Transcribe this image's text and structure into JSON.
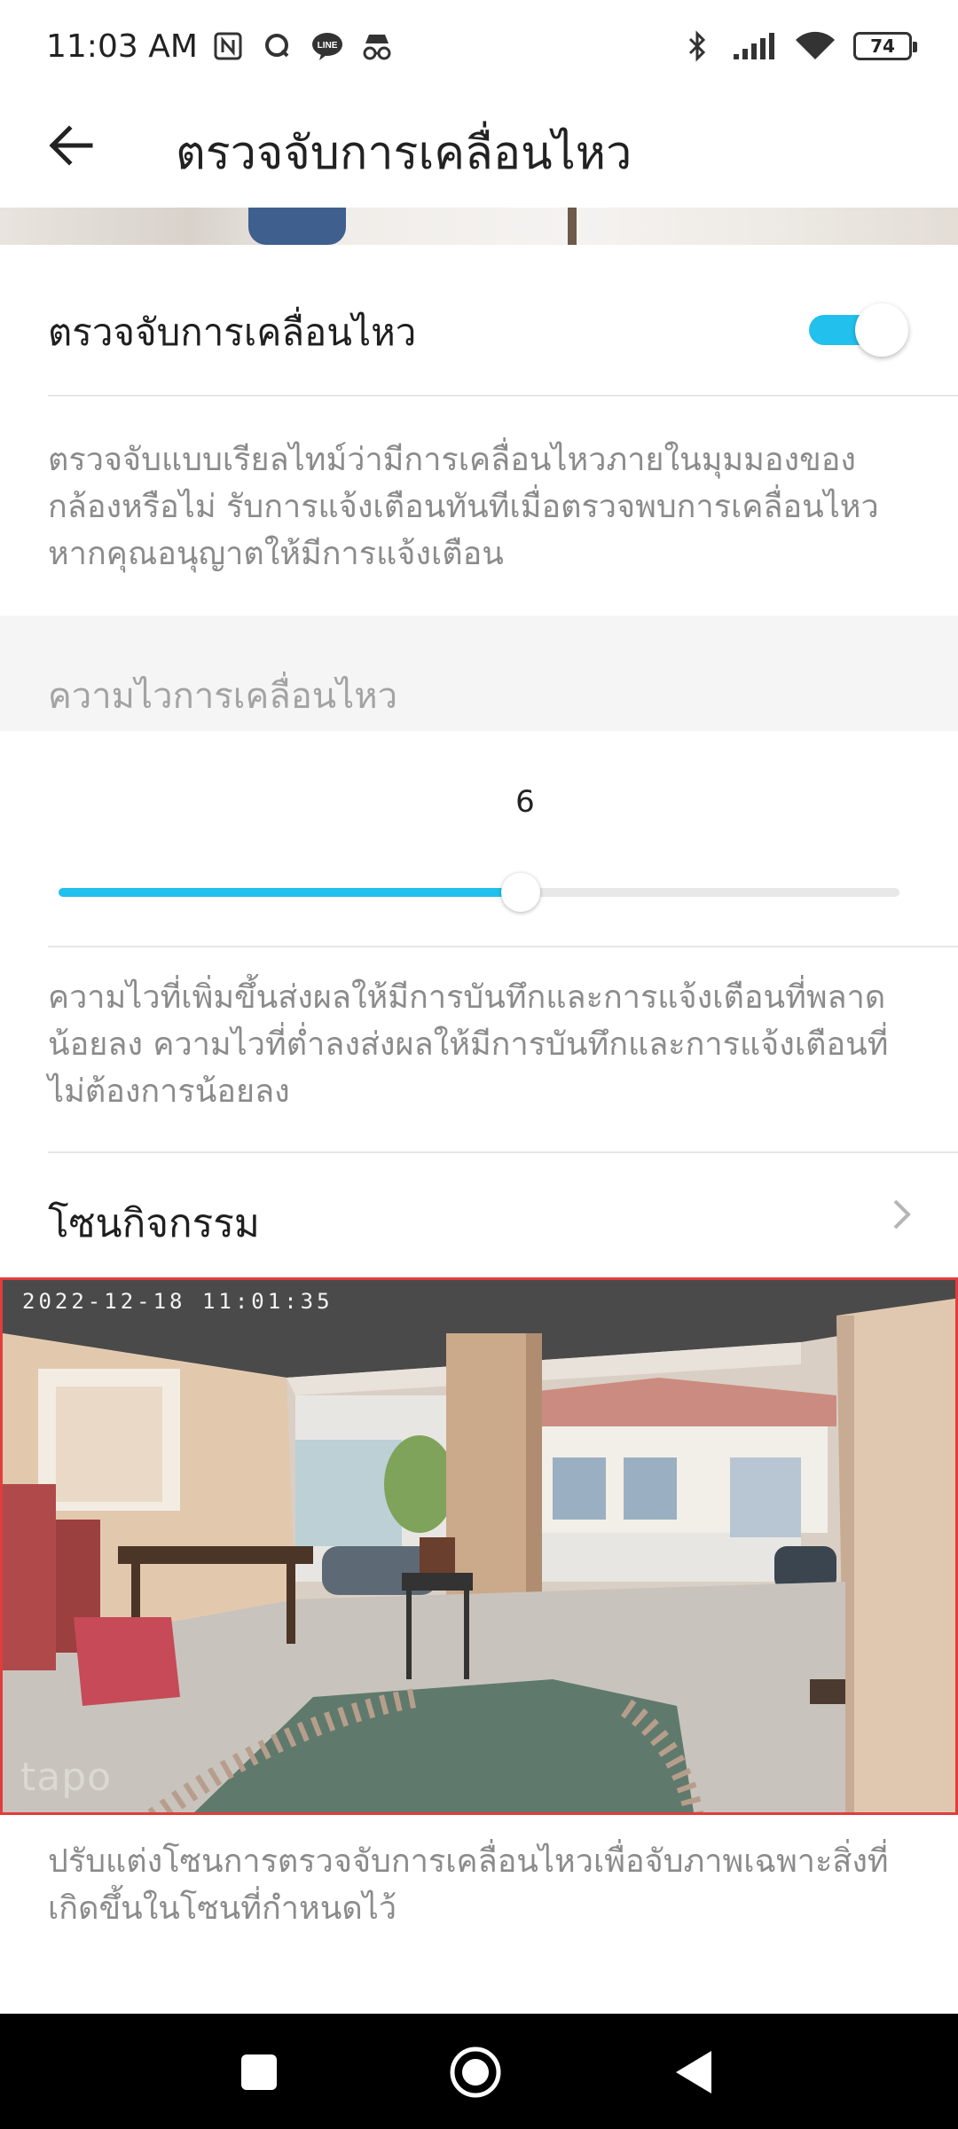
{
  "status_bar": {
    "time": "11:03 AM",
    "battery": "74",
    "icons": [
      "nfc-icon",
      "chat-icon",
      "line-icon",
      "incognito-icon",
      "bluetooth-icon",
      "signal-icon",
      "wifi-icon",
      "battery-icon"
    ]
  },
  "app_bar": {
    "title": "ตรวจจับการเคลื่อนไหว",
    "back_icon": "arrow-left-icon"
  },
  "motion_detection": {
    "label": "ตรวจจับการเคลื่อนไหว",
    "enabled": true,
    "description": "ตรวจจับแบบเรียลไทม์ว่ามีการเคลื่อนไหวภายในมุมมองของกล้องหรือไม่ รับการแจ้งเตือนทันทีเมื่อตรวจพบการเคลื่อนไหว หากคุณอนุญาตให้มีการแจ้งเตือน"
  },
  "sensitivity": {
    "header": "ความไวการเคลื่อนไหว",
    "value": "6",
    "fraction": 0.55,
    "description": "ความไวที่เพิ่มขึ้นส่งผลให้มีการบันทึกและการแจ้งเตือนที่พลาดน้อยลง ความไวที่ต่ำลงส่งผลให้มีการบันทึกและการแจ้งเตือนที่ไม่ต้องการน้อยลง"
  },
  "activity_zone": {
    "label": "โซนกิจกรรม",
    "chevron_icon": "chevron-right-icon",
    "timestamp": "2022-12-18 11:01:35",
    "watermark": "tapo",
    "zone_border_color": "#e23c3c",
    "description": "ปรับแต่งโซนการตรวจจับการเคลื่อนไหวเพื่อจับภาพเฉพาะสิ่งที่เกิดขึ้นในโซนที่กำหนดไว้"
  },
  "colors": {
    "accent": "#22c0ec",
    "text_primary": "#1f1f1f",
    "text_secondary": "#8b8b8b"
  },
  "nav_bar": {
    "icons": [
      "recents-icon",
      "home-icon",
      "back-triangle-icon"
    ]
  }
}
